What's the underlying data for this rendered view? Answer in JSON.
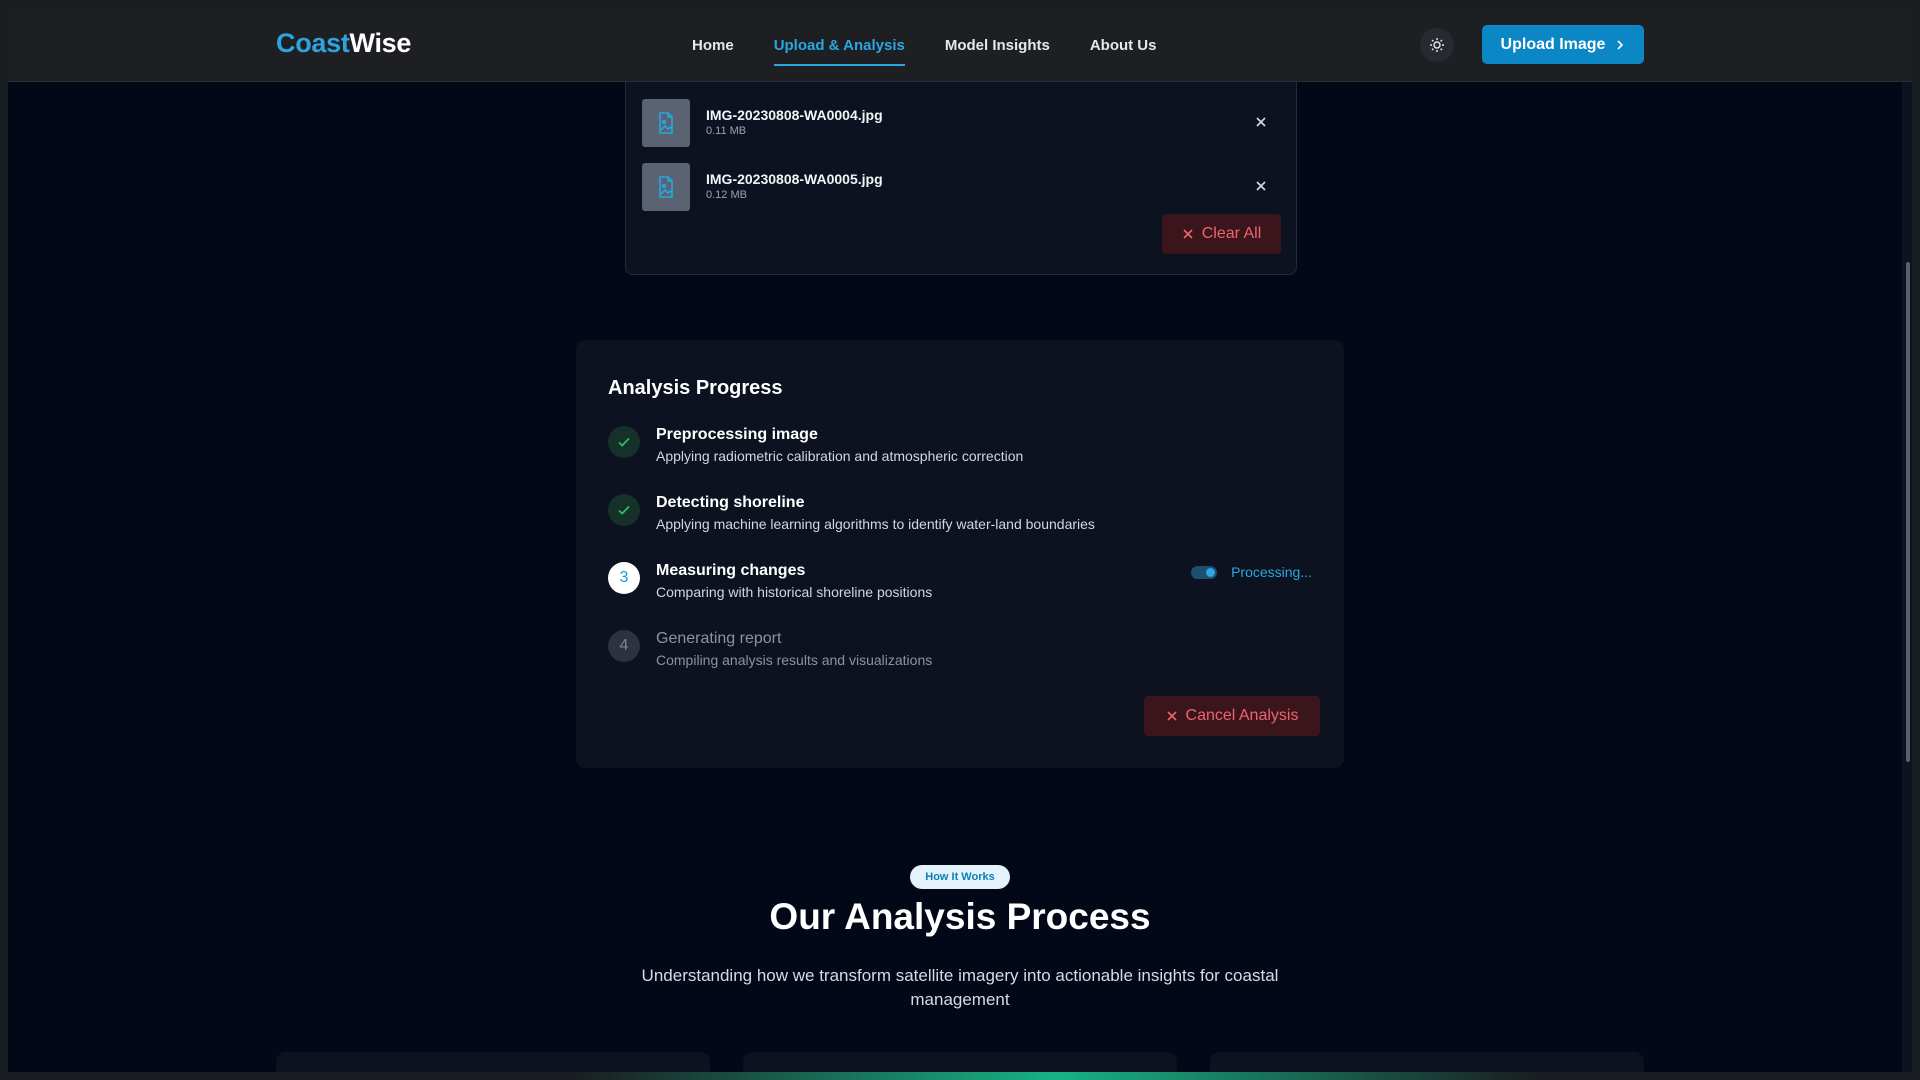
{
  "header": {
    "logo_part1": "Coast",
    "logo_part2": "Wise",
    "nav": [
      {
        "label": "Home"
      },
      {
        "label": "Upload & Analysis"
      },
      {
        "label": "Model Insights"
      },
      {
        "label": "About Us"
      }
    ],
    "active_nav": "Upload & Analysis",
    "theme_icon": "sun-icon",
    "upload_button_label": "Upload Image"
  },
  "files": {
    "items": [
      {
        "name": "IMG-20230808-WA0004.jpg",
        "size": "0.11 MB"
      },
      {
        "name": "IMG-20230808-WA0005.jpg",
        "size": "0.12 MB"
      }
    ],
    "clear_all_label": "Clear All"
  },
  "progress": {
    "title": "Analysis Progress",
    "steps": [
      {
        "status": "done",
        "title": "Preprocessing image",
        "desc": "Applying radiometric calibration and atmospheric correction"
      },
      {
        "status": "done",
        "title": "Detecting shoreline",
        "desc": "Applying machine learning algorithms to identify water-land boundaries"
      },
      {
        "status": "current",
        "number": "3",
        "title": "Measuring changes",
        "desc": "Comparing with historical shoreline positions",
        "status_label": "Processing..."
      },
      {
        "status": "pending",
        "number": "4",
        "title": "Generating report",
        "desc": "Compiling analysis results and visualizations"
      }
    ],
    "cancel_label": "Cancel Analysis"
  },
  "how_it_works": {
    "badge": "How It Works",
    "title": "Our Analysis Process",
    "subtitle": "Understanding how we transform satellite imagery into actionable insights for coastal management"
  },
  "colors": {
    "accent": "#2aa6e0",
    "primary_button": "#0b87c6",
    "danger": "#f0636c",
    "success": "#22c55e",
    "background": "#020817"
  }
}
